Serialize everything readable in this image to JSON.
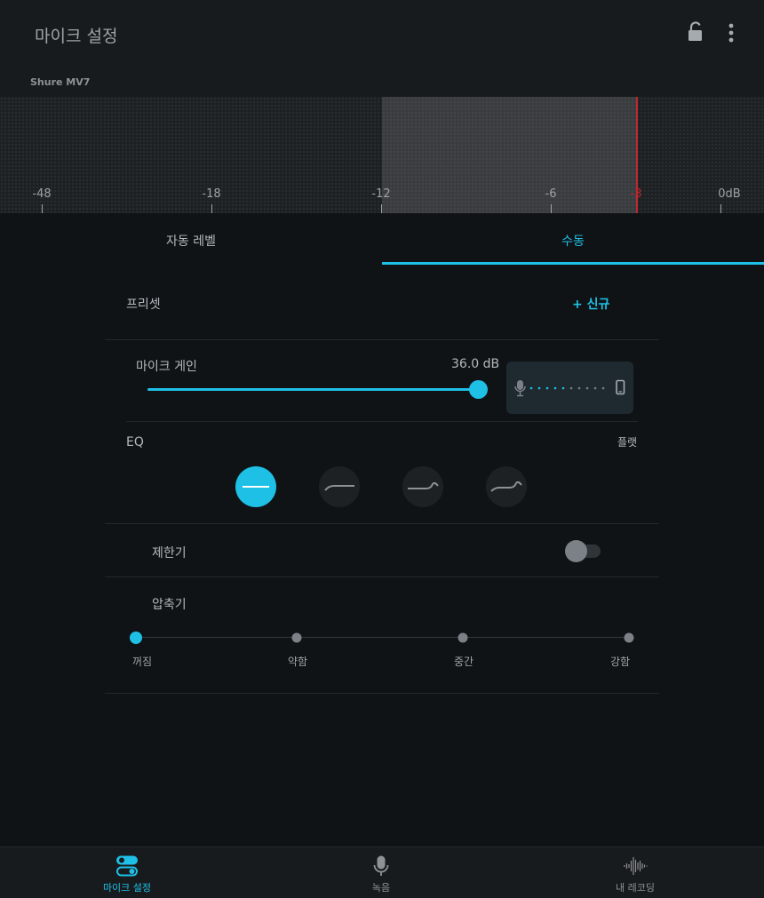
{
  "header": {
    "title": "마이크 설정",
    "icons": [
      "lock-open-icon",
      "more-vert-icon"
    ]
  },
  "meter": {
    "device_name": "Shure MV7",
    "scale_labels": [
      "-48",
      "-18",
      "-12",
      "-6",
      "-3",
      "0dB"
    ],
    "target_range_db": [
      -12,
      -3
    ],
    "peak_db": -3,
    "colors": {
      "peak": "#c0262f",
      "range": "#3a3d40"
    }
  },
  "tabs": [
    {
      "label": "자동 레벨",
      "active": false
    },
    {
      "label": "수동",
      "active": true
    }
  ],
  "preset": {
    "label": "프리셋",
    "new_label": "+ 신규"
  },
  "gain": {
    "label": "마이크 게인",
    "value_text": "36.0 dB",
    "level": 1.0,
    "routing_icons": [
      "microphone-icon",
      "phone-icon"
    ]
  },
  "eq": {
    "label": "EQ",
    "current": "플랫",
    "options": [
      "flat-eq-icon",
      "low-cut-eq-icon",
      "presence-eq-icon",
      "low-cut-presence-eq-icon"
    ],
    "selected_index": 0
  },
  "limiter": {
    "label": "제한기",
    "enabled": false
  },
  "compressor": {
    "label": "압축기",
    "levels": [
      "꺼짐",
      "약함",
      "중간",
      "강함"
    ],
    "selected_index": 0
  },
  "bottom_nav": [
    {
      "label": "마이크 설정",
      "icon": "toggles-icon",
      "active": true
    },
    {
      "label": "녹음",
      "icon": "microphone-icon",
      "active": false
    },
    {
      "label": "내 레코딩",
      "icon": "waveform-icon",
      "active": false
    }
  ],
  "colors": {
    "accent": "#1ec0e6",
    "background": "#101316",
    "surface": "#181b1e"
  }
}
